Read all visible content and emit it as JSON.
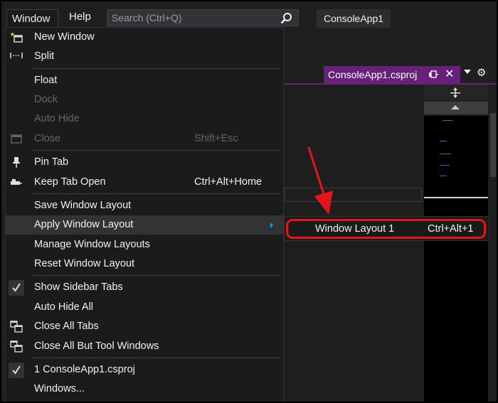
{
  "menubar": {
    "items": [
      "Window",
      "Help"
    ],
    "search_placeholder": "Search (Ctrl+Q)",
    "app_title": "ConsoleApp1"
  },
  "document": {
    "tab_label": "ConsoleApp1.csproj",
    "accent": "#68217a"
  },
  "window_menu": {
    "items": [
      {
        "label": "New Window",
        "shortcut": "",
        "icon": "new-window-icon",
        "enabled": true
      },
      {
        "label": "Split",
        "shortcut": "",
        "icon": "split-icon",
        "enabled": true
      },
      {
        "label": "Float",
        "shortcut": "",
        "icon": "",
        "enabled": true
      },
      {
        "label": "Dock",
        "shortcut": "",
        "icon": "",
        "enabled": false
      },
      {
        "label": "Auto Hide",
        "shortcut": "",
        "icon": "",
        "enabled": false
      },
      {
        "label": "Close",
        "shortcut": "Shift+Esc",
        "icon": "close-window-icon",
        "enabled": false
      },
      {
        "label": "Pin Tab",
        "shortcut": "",
        "icon": "pin-icon",
        "enabled": true
      },
      {
        "label": "Keep Tab Open",
        "shortcut": "Ctrl+Alt+Home",
        "icon": "keep-open-icon",
        "enabled": true
      },
      {
        "label": "Save Window Layout",
        "shortcut": "",
        "icon": "",
        "enabled": true
      },
      {
        "label": "Apply Window Layout",
        "shortcut": "",
        "icon": "",
        "enabled": true,
        "submenu": true,
        "highlighted": true
      },
      {
        "label": "Manage Window Layouts",
        "shortcut": "",
        "icon": "",
        "enabled": true
      },
      {
        "label": "Reset Window Layout",
        "shortcut": "",
        "icon": "",
        "enabled": true
      },
      {
        "label": "Show Sidebar Tabs",
        "shortcut": "",
        "icon": "checkmark-icon",
        "enabled": true,
        "checked": true
      },
      {
        "label": "Auto Hide All",
        "shortcut": "",
        "icon": "",
        "enabled": true
      },
      {
        "label": "Close All Tabs",
        "shortcut": "",
        "icon": "close-all-icon",
        "enabled": true
      },
      {
        "label": "Close All But Tool Windows",
        "shortcut": "",
        "icon": "close-all-icon",
        "enabled": true
      },
      {
        "label": "1 ConsoleApp1.csproj",
        "shortcut": "",
        "icon": "checkmark-icon",
        "enabled": true,
        "checked": true
      },
      {
        "label": "Windows...",
        "shortcut": "",
        "icon": "",
        "enabled": true
      }
    ]
  },
  "submenu": {
    "label": "Window Layout 1",
    "shortcut": "Ctrl+Alt+1",
    "highlight_color": "#e3141c"
  },
  "colors": {
    "menu_bg": "#1b1b1c",
    "disabled_text": "#656565",
    "annotation": "#e3141c"
  }
}
